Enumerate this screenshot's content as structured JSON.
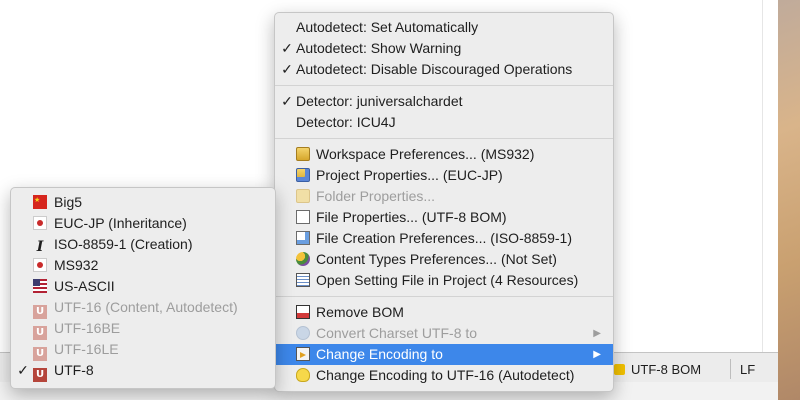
{
  "status_bar": {
    "encoding": "UTF-8 BOM",
    "line_ending": "LF"
  },
  "main_menu": {
    "items": [
      {
        "label": "Autodetect: Set Automatically",
        "checked": false
      },
      {
        "label": "Autodetect: Show Warning",
        "checked": true
      },
      {
        "label": "Autodetect: Disable Discouraged Operations",
        "checked": true
      },
      {
        "label": "Detector: juniversalchardet",
        "checked": true
      },
      {
        "label": "Detector: ICU4J",
        "checked": false
      },
      {
        "label": "Workspace Preferences... (MS932)",
        "icon": "workspace-folder-icon"
      },
      {
        "label": "Project Properties... (EUC-JP)",
        "icon": "project-folder-icon"
      },
      {
        "label": "Folder Properties...",
        "icon": "folder-icon",
        "disabled": true
      },
      {
        "label": "File Properties... (UTF-8 BOM)",
        "icon": "file-icon"
      },
      {
        "label": "File Creation Preferences... (ISO-8859-1)",
        "icon": "file-creation-icon"
      },
      {
        "label": "Content Types Preferences... (Not Set)",
        "icon": "content-types-icon"
      },
      {
        "label": "Open Setting File in Project (4 Resources)",
        "icon": "settings-file-icon"
      },
      {
        "label": "Remove BOM",
        "icon": "remove-bom-icon"
      },
      {
        "label": "Convert Charset UTF-8 to",
        "icon": "convert-charset-icon",
        "disabled": true
      },
      {
        "label": "Change Encoding to",
        "icon": "change-encoding-icon",
        "highlighted": true
      },
      {
        "label": "Change Encoding to UTF-16 (Autodetect)",
        "icon": "lightbulb-icon"
      }
    ],
    "check_mark": "✓",
    "submenu_arrow": "▶"
  },
  "encoding_submenu": {
    "items": [
      {
        "label": "Big5",
        "icon": "china-flag-icon"
      },
      {
        "label": "EUC-JP (Inheritance)",
        "icon": "japan-flag-icon"
      },
      {
        "label": "ISO-8859-1 (Creation)",
        "icon": "latin-l-icon"
      },
      {
        "label": "MS932",
        "icon": "japan-flag-icon"
      },
      {
        "label": "US-ASCII",
        "icon": "us-flag-icon"
      },
      {
        "label": "UTF-16 (Content, Autodetect)",
        "icon": "unicode-icon",
        "disabled": true
      },
      {
        "label": "UTF-16BE",
        "icon": "unicode-icon",
        "disabled": true
      },
      {
        "label": "UTF-16LE",
        "icon": "unicode-icon",
        "disabled": true
      },
      {
        "label": "UTF-8",
        "icon": "unicode-icon",
        "checked": true
      }
    ],
    "latin_glyph": "I",
    "unicode_glyph": "U"
  },
  "colors": {
    "highlight": "#3d87ea",
    "menu_bg": "#ededed",
    "disabled_text": "#9d9d9d"
  }
}
